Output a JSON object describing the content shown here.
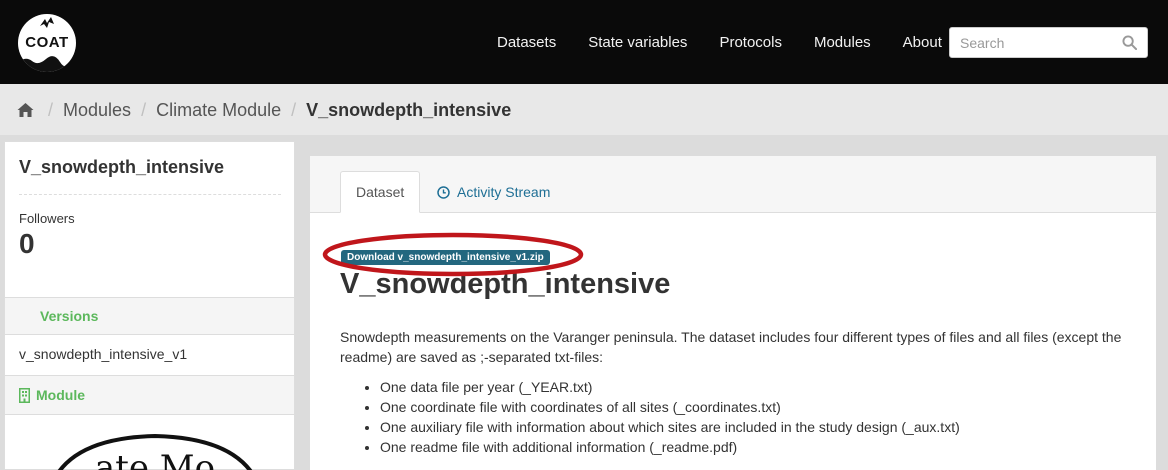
{
  "header": {
    "logo_text": "COAT",
    "nav": [
      "Datasets",
      "State variables",
      "Protocols",
      "Modules",
      "About"
    ],
    "search_placeholder": "Search"
  },
  "breadcrumb": [
    "Modules",
    "Climate Module",
    "V_snowdepth_intensive"
  ],
  "sidebar": {
    "title": "V_snowdepth_intensive",
    "followers_label": "Followers",
    "followers_count": "0",
    "versions_label": "Versions",
    "version_item": "v_snowdepth_intensive_v1",
    "module_label": "Module",
    "module_logo_text": "ate Mo"
  },
  "tabs": [
    "Dataset",
    "Activity Stream"
  ],
  "content": {
    "download_label": "Download v_snowdepth_intensive_v1.zip",
    "title": "V_snowdepth_intensive",
    "description": "Snowdepth measurements on the Varanger peninsula. The dataset includes four different types of files and all files (except the readme) are saved as ;-separated txt-files:",
    "bullets": [
      "One data file per year (_YEAR.txt)",
      "One coordinate file with coordinates of all sites (_coordinates.txt)",
      "One auxiliary file with information about which sites are included in the study design (_aux.txt)",
      "One readme file with additional information (_readme.pdf)"
    ]
  },
  "colors": {
    "topbar": "#0a0a0a",
    "accent_green": "#5cb85c",
    "link_blue": "#1f6f95",
    "badge": "#23677f",
    "annotation_red": "#c0161b"
  }
}
